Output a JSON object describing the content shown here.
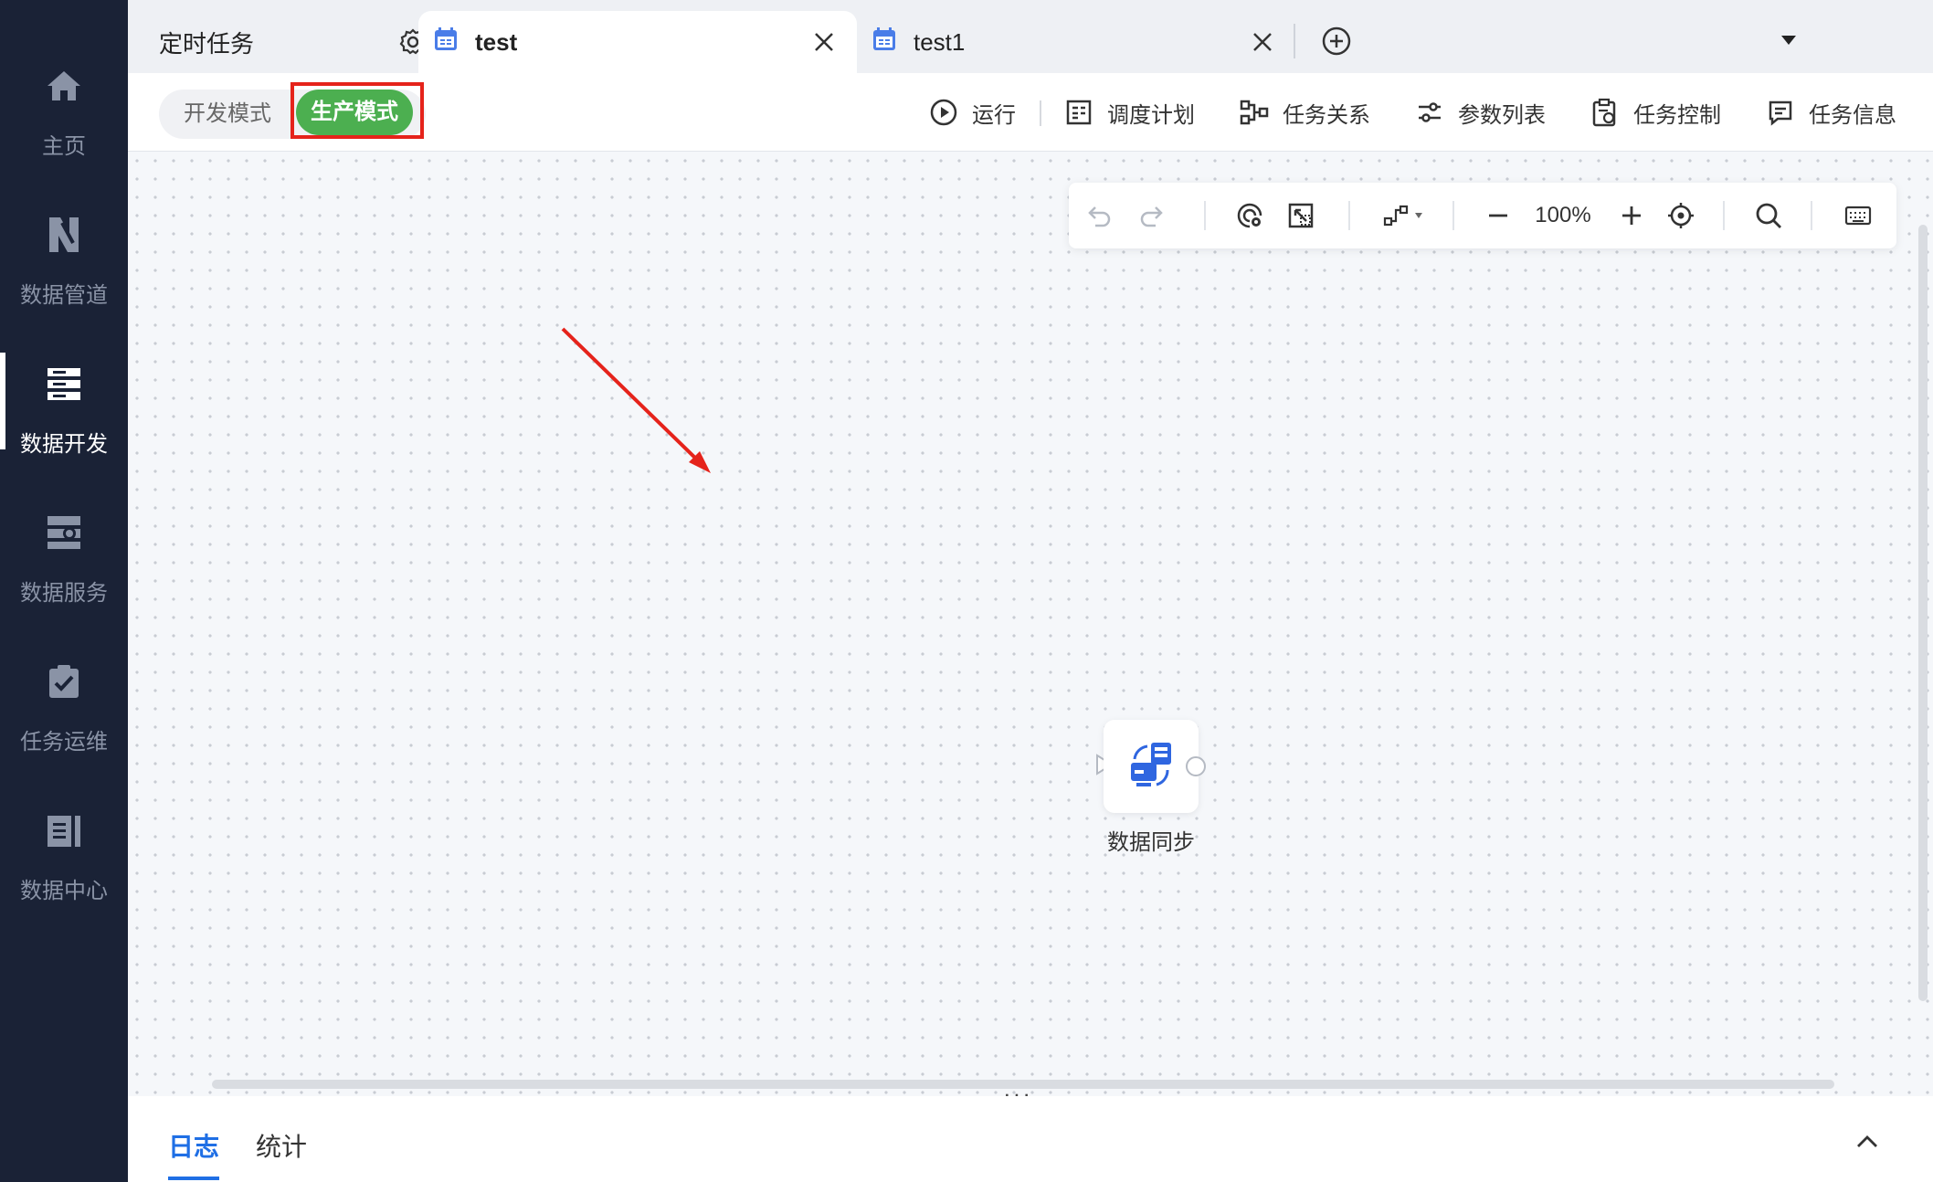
{
  "sidebar": {
    "items": [
      {
        "label": "主页",
        "icon": "home-icon"
      },
      {
        "label": "数据管道",
        "icon": "pipeline-icon"
      },
      {
        "label": "数据开发",
        "icon": "data-dev-icon",
        "active": true
      },
      {
        "label": "数据服务",
        "icon": "data-service-icon"
      },
      {
        "label": "任务运维",
        "icon": "task-ops-icon"
      },
      {
        "label": "数据中心",
        "icon": "data-center-icon"
      }
    ]
  },
  "tabs": {
    "scheduled": "定时任务",
    "test": "test",
    "test1": "test1"
  },
  "toolbar": {
    "mode_dev": "开发模式",
    "mode_prod": "生产模式",
    "run": "运行",
    "schedule": "调度计划",
    "relation": "任务关系",
    "params": "参数列表",
    "control": "任务控制",
    "info": "任务信息"
  },
  "canvas": {
    "zoom": "100%",
    "node_label": "数据同步"
  },
  "bottom": {
    "log": "日志",
    "stats": "统计"
  },
  "colors": {
    "sidebar_bg": "#1a2236",
    "accent_blue": "#1f6fe5",
    "prod_green": "#4caf50",
    "highlight_red": "#e5231b"
  }
}
